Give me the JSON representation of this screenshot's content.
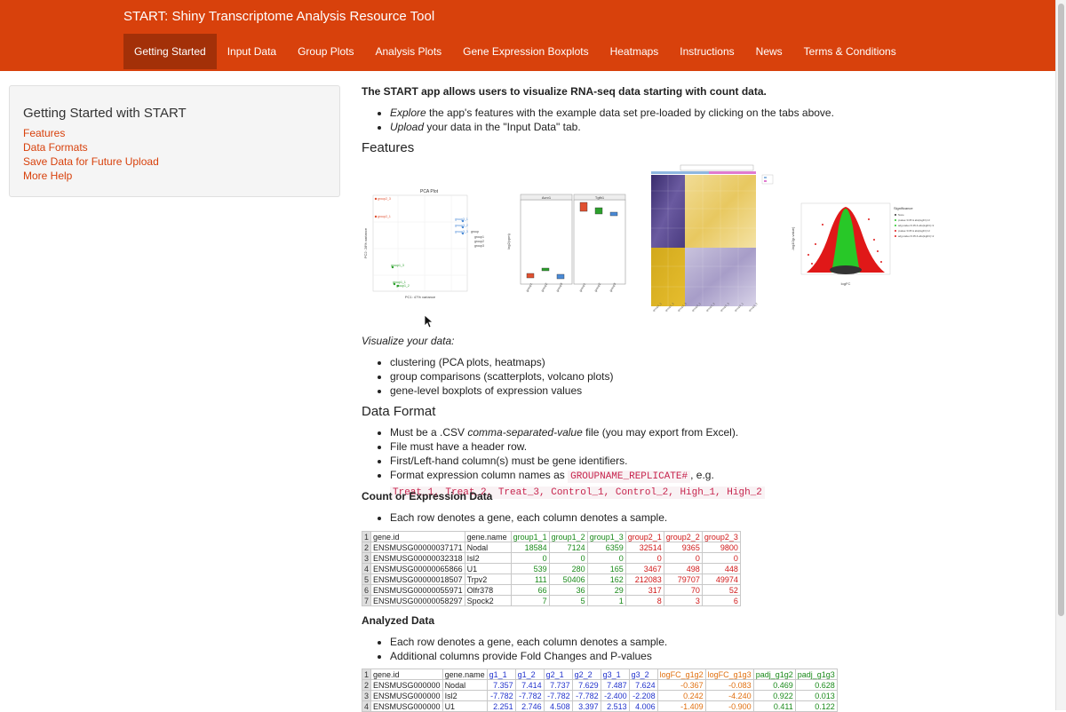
{
  "navbar": {
    "brand": "START: Shiny Transcriptome Analysis Resource Tool",
    "tabs": [
      "Getting Started",
      "Input Data",
      "Group Plots",
      "Analysis Plots",
      "Gene Expression Boxplots",
      "Heatmaps",
      "Instructions",
      "News",
      "Terms & Conditions"
    ],
    "active_tab": "Getting Started",
    "color": "#d8410c"
  },
  "sidebar": {
    "title": "Getting Started with START",
    "links": [
      "Features",
      "Data Formats",
      "Save Data for Future Upload",
      "More Help"
    ]
  },
  "main": {
    "intro": "The START app allows users to visualize RNA-seq data starting with count data.",
    "intro_bullets": [
      {
        "em": "Explore",
        "text": " the app's features with the example data set pre-loaded by clicking on the tabs above."
      },
      {
        "em": "Upload",
        "text": " your data in the \"Input Data\" tab."
      }
    ],
    "features_heading": "Features",
    "figures": {
      "pca": {
        "title": "PCA Plot",
        "xlabel": "PC1: 47% variance",
        "ylabel": "PC2: 28% variance",
        "legend_title": "group",
        "legend": [
          "group1",
          "group2",
          "group3"
        ]
      },
      "boxplot": {
        "panels": [
          "Acrv1",
          "Tgfb1"
        ],
        "ylabel": "log2(cpm)",
        "groups": [
          "group1",
          "group2",
          "group3"
        ]
      },
      "volcano": {
        "xlabel": "logFC",
        "ylabel": "-log10(p.value)",
        "legend_title": "Significance"
      }
    },
    "visualize_label": "Visualize your data:",
    "visualize_bullets": [
      "clustering (PCA plots, heatmaps)",
      "group comparisons (scatterplots, volcano plots)",
      "gene-level boxplots of expression values"
    ],
    "data_format_heading": "Data Format",
    "format_bullets": {
      "b1_pre": "Must be a .CSV ",
      "b1_em": "comma-separated-value",
      "b1_post": " file (you may export from Excel).",
      "b2": "File must have a header row.",
      "b3": "First/Left-hand column(s) must be gene identifiers.",
      "b4_pre": "Format expression column names as ",
      "b4_code1": "GROUPNAME_REPLICATE#",
      "b4_mid": ", e.g. ",
      "b4_code2": "Treat_1, Treat_2, Treat_3, Control_1, Control_2, High_1, High_2"
    },
    "count_heading": "Count or Expression Data",
    "count_bullets": [
      "Each row denotes a gene, each column denotes a sample."
    ],
    "analyzed_heading": "Analyzed Data",
    "analyzed_bullets": [
      "Each row denotes a gene, each column denotes a sample.",
      "Additional columns provide Fold Changes and P-values"
    ]
  },
  "count_table": {
    "header": [
      "gene.id",
      "gene.name",
      "group1_1",
      "group1_2",
      "group1_3",
      "group2_1",
      "group2_2",
      "group2_3"
    ],
    "rows": [
      [
        "ENSMUSG00000037171",
        "Nodal",
        "18584",
        "7124",
        "6359",
        "32514",
        "9365",
        "9800"
      ],
      [
        "ENSMUSG00000032318",
        "Isl2",
        "0",
        "0",
        "0",
        "0",
        "0",
        "0"
      ],
      [
        "ENSMUSG00000065866",
        "U1",
        "539",
        "280",
        "165",
        "3467",
        "498",
        "448"
      ],
      [
        "ENSMUSG00000018507",
        "Trpv2",
        "111",
        "50406",
        "162",
        "212083",
        "79707",
        "49974"
      ],
      [
        "ENSMUSG00000055971",
        "Olfr378",
        "66",
        "36",
        "29",
        "317",
        "70",
        "52"
      ],
      [
        "ENSMUSG00000058297",
        "Spock2",
        "7",
        "5",
        "1",
        "8",
        "3",
        "6"
      ]
    ]
  },
  "analyzed_table": {
    "header": [
      "gene.id",
      "gene.name",
      "g1_1",
      "g1_2",
      "g2_1",
      "g2_2",
      "g3_1",
      "g3_2",
      "logFC_g1g2",
      "logFC_g1g3",
      "padj_g1g2",
      "padj_g1g3"
    ],
    "rows": [
      [
        "ENSMUSG000000",
        "Nodal",
        "7.357",
        "7.414",
        "7.737",
        "7.629",
        "7.487",
        "7.624",
        "-0.367",
        "-0.083",
        "0.469",
        "0.628"
      ],
      [
        "ENSMUSG000000",
        "Isl2",
        "-7.782",
        "-7.782",
        "-7.782",
        "-7.782",
        "-2.400",
        "-2.208",
        "0.242",
        "-4.240",
        "0.922",
        "0.013"
      ],
      [
        "ENSMUSG000000",
        "U1",
        "2.251",
        "2.746",
        "4.508",
        "3.397",
        "2.513",
        "4.006",
        "-1.409",
        "-0.900",
        "0.411",
        "0.122"
      ]
    ]
  }
}
